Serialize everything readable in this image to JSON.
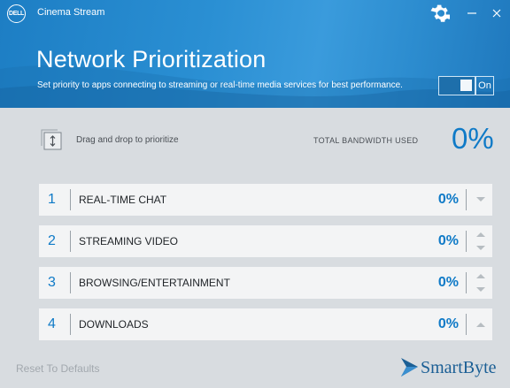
{
  "window": {
    "logo_text": "DELL",
    "app_title": "Cinema Stream"
  },
  "header": {
    "title": "Network Prioritization",
    "subtitle": "Set priority to apps connecting to streaming or real-time media services for best performance.",
    "toggle_state": "On"
  },
  "bandwidth": {
    "drag_hint": "Drag and drop to prioritize",
    "label": "TOTAL BANDWIDTH USED",
    "value": "0%"
  },
  "priorities": [
    {
      "rank": "1",
      "name": "REAL-TIME CHAT",
      "percent": "0%",
      "arrows": [
        "down"
      ]
    },
    {
      "rank": "2",
      "name": "STREAMING VIDEO",
      "percent": "0%",
      "arrows": [
        "up",
        "down"
      ]
    },
    {
      "rank": "3",
      "name": "BROWSING/ENTERTAINMENT",
      "percent": "0%",
      "arrows": [
        "up",
        "down"
      ]
    },
    {
      "rank": "4",
      "name": "DOWNLOADS",
      "percent": "0%",
      "arrows": [
        "up"
      ]
    }
  ],
  "footer": {
    "reset_label": "Reset To Defaults",
    "brand": "SmartByte"
  },
  "colors": {
    "header_blue": "#2a8fd3",
    "accent_blue": "#0f7ac7",
    "background": "#d8dce0",
    "row_background": "#f3f4f5"
  },
  "icons": {
    "logo": "dell-logo",
    "settings": "gear-icon",
    "minimize": "minimize-icon",
    "close": "close-icon",
    "drag": "drag-drop-icon",
    "brand": "smartbyte-logo-icon"
  }
}
